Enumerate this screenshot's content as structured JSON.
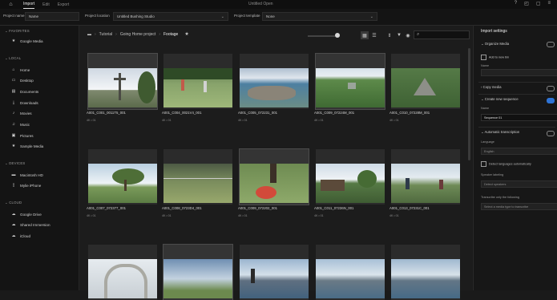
{
  "app": {
    "title": "Untitled Open",
    "tabs": [
      "Import",
      "Edit",
      "Export"
    ],
    "active_tab": 0
  },
  "options": {
    "location_label": "Project name",
    "location_value": "Name",
    "location_label2": "Project location",
    "location_value2": "Untitled Bushing Studio",
    "template_label": "Project template",
    "template_value": "None"
  },
  "sidebar": {
    "sections": [
      {
        "title": "FAVORITES",
        "items": [
          {
            "icon": "star-icon",
            "label": "Google Media"
          }
        ]
      },
      {
        "title": "LOCAL",
        "items": [
          {
            "icon": "home-icon",
            "label": "Home"
          },
          {
            "icon": "desktop-icon",
            "label": "Desktop"
          },
          {
            "icon": "document-icon",
            "label": "Documents"
          },
          {
            "icon": "download-icon",
            "label": "Downloads"
          },
          {
            "icon": "music-icon",
            "label": "Movies"
          },
          {
            "icon": "music-icon",
            "label": "Music"
          },
          {
            "icon": "picture-icon",
            "label": "Pictures"
          },
          {
            "icon": "star-icon",
            "label": "Sample Media"
          }
        ]
      },
      {
        "title": "DEVICES",
        "items": [
          {
            "icon": "drive-icon",
            "label": "Macintosh HD"
          },
          {
            "icon": "phone-icon",
            "label": "Mylie iPhone"
          }
        ]
      },
      {
        "title": "CLOUD",
        "items": [
          {
            "icon": "cloud-icon",
            "label": "Google Drive"
          },
          {
            "icon": "cloud-icon",
            "label": "Shared Immersion"
          },
          {
            "icon": "cloud-icon",
            "label": "iCloud"
          }
        ]
      }
    ]
  },
  "breadcrumbs": [
    "Tutorial",
    "Going Home project",
    "Footage"
  ],
  "search": {
    "placeholder": ""
  },
  "clips": [
    {
      "name": "A001_C001_0011T5_001",
      "meta": "4K • 01",
      "scene": "cross"
    },
    {
      "name": "A001_C004_0021V4_001",
      "meta": "4K • 01",
      "scene": "kids"
    },
    {
      "name": "A001_C005_072231_001",
      "meta": "4K • 01",
      "scene": "aerial"
    },
    {
      "name": "A001_C009_07224M_001",
      "meta": "4K • 01",
      "scene": "jungle"
    },
    {
      "name": "A001_C010_07228M_001",
      "meta": "4K • 01",
      "scene": "ruins"
    },
    {
      "name": "A001_C007_072377_001",
      "meta": "4K • 01",
      "scene": "tree"
    },
    {
      "name": "A001_C008_0723D4_001",
      "meta": "4K • 01",
      "scene": "field"
    },
    {
      "name": "A001_C009_072202_001",
      "meta": "4K • 01",
      "scene": "ball"
    },
    {
      "name": "A001_C011_07236N_001",
      "meta": "4K • 01",
      "scene": "village"
    },
    {
      "name": "A001_C013_07231C_001",
      "meta": "4K • 01",
      "scene": "people"
    },
    {
      "name": "",
      "meta": "",
      "scene": "arch"
    },
    {
      "name": "",
      "meta": "",
      "scene": "sky"
    },
    {
      "name": "",
      "meta": "",
      "scene": "lake"
    },
    {
      "name": "",
      "meta": "",
      "scene": "lake2"
    },
    {
      "name": "",
      "meta": "",
      "scene": "lake3"
    }
  ],
  "panel": {
    "title": "Import settings",
    "copy_media": "Copy media",
    "organize": "Organize Media",
    "add_to_bin": "Add to new bin",
    "name_label": "Name",
    "name_value": "",
    "create_sequence": "Create new sequence",
    "seq_name_label": "Name",
    "seq_name_value": "Sequence 01",
    "auto_transcribe": "Automatic transcription",
    "language_label": "Language",
    "language_value": "English",
    "detect_label": "Detect languages automatically",
    "speaker_label": "Speaker labeling",
    "speaker_value": "Detect speakers",
    "transcribe_label": "Transcribe only the following",
    "transcribe_value": "Select a media type to transcribe"
  },
  "colors": {
    "accent": "#2f74d6",
    "bg": "#1a1a1a"
  }
}
